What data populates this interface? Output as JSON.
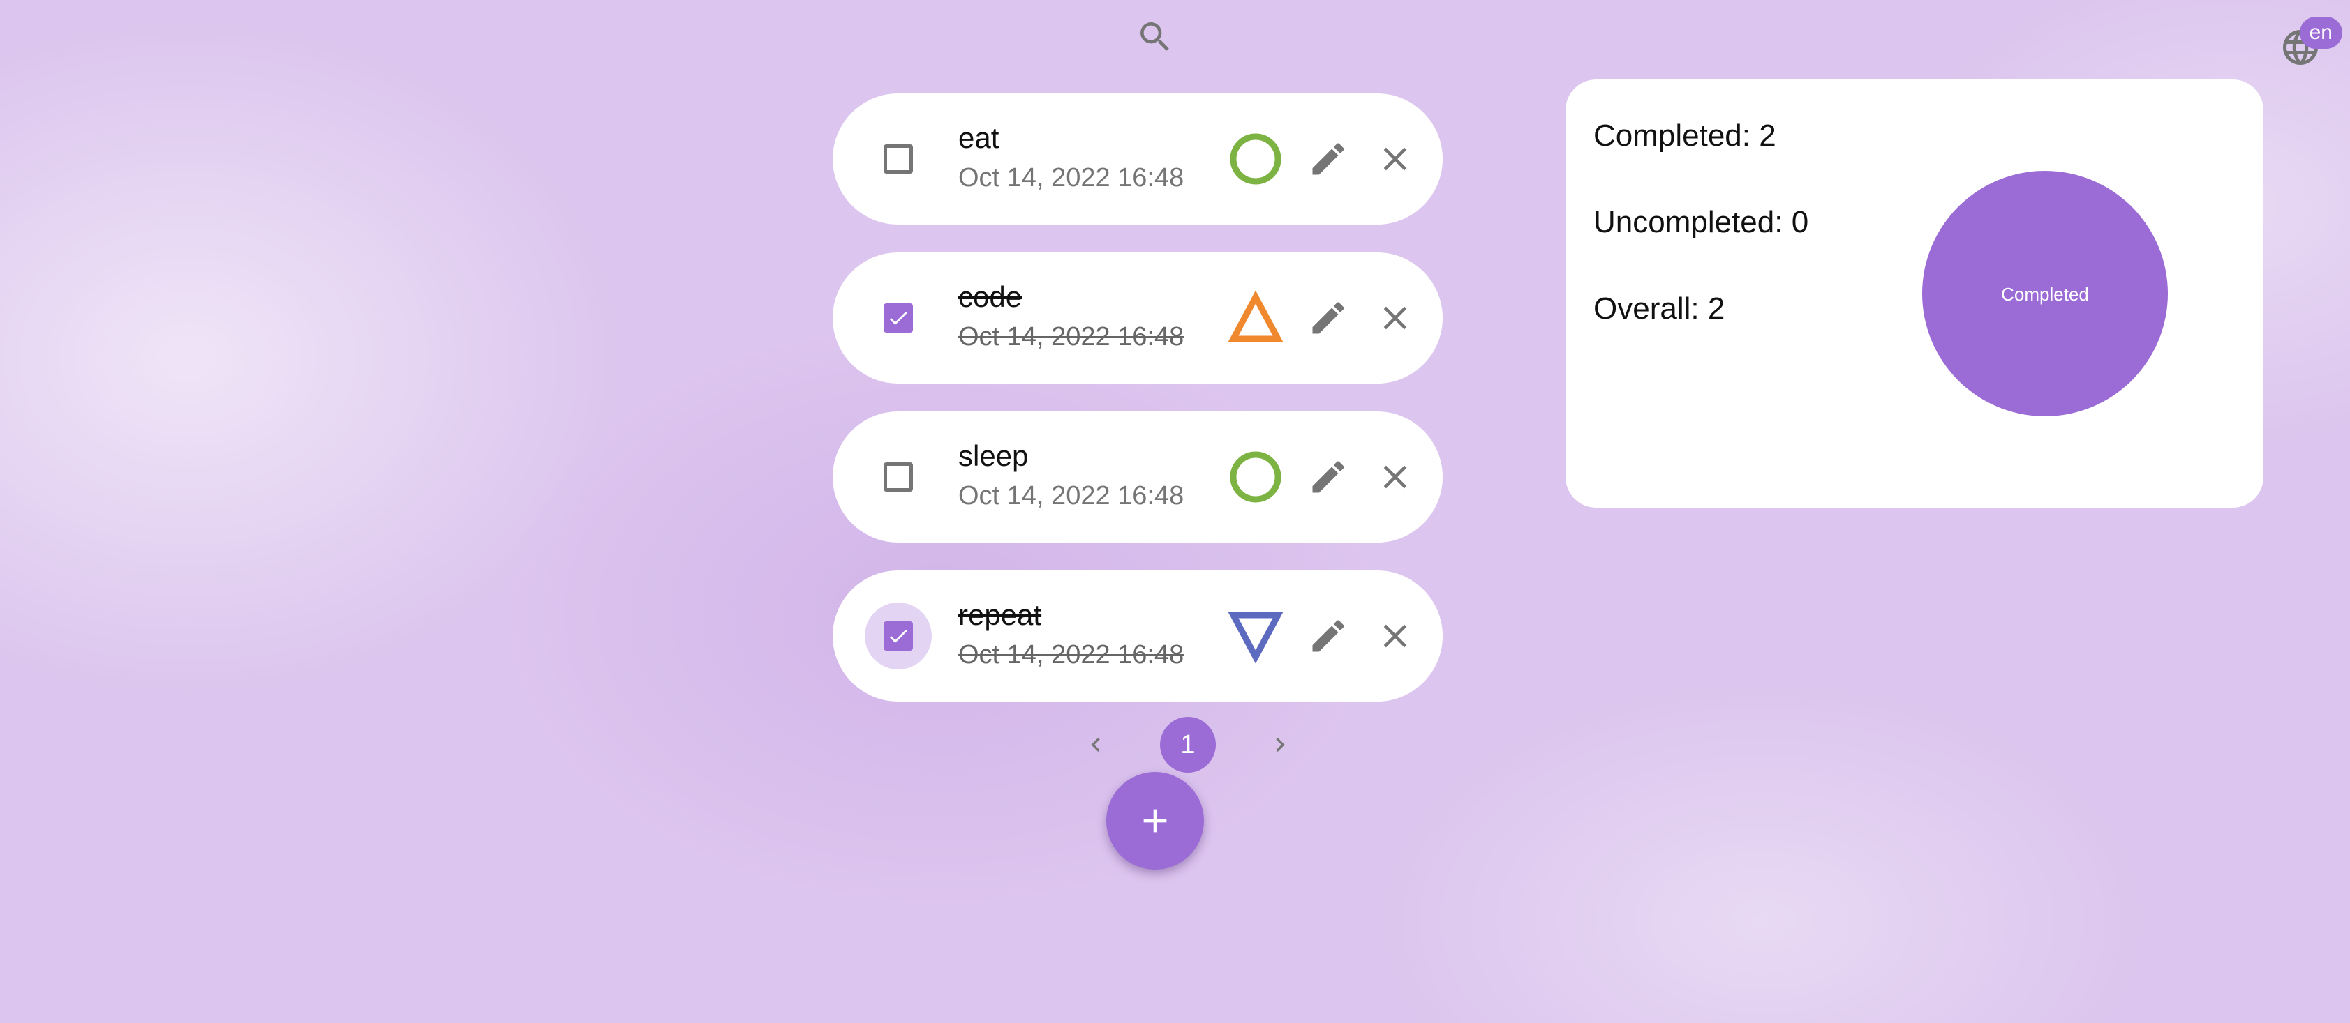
{
  "header": {
    "search_icon": "search-icon",
    "language_icon": "globe-icon",
    "language": "en"
  },
  "tasks": [
    {
      "title": "eat",
      "date": "Oct 14, 2022 16:48",
      "completed": false,
      "priority_icon": "circle-icon",
      "priority_color": "#7cb342"
    },
    {
      "title": "code",
      "date": "Oct 14, 2022 16:48",
      "completed": true,
      "priority_icon": "triangle-up-icon",
      "priority_color": "#f0882e"
    },
    {
      "title": "sleep",
      "date": "Oct 14, 2022 16:48",
      "completed": false,
      "priority_icon": "circle-icon",
      "priority_color": "#7cb342"
    },
    {
      "title": "repeat",
      "date": "Oct 14, 2022 16:48",
      "completed": true,
      "priority_icon": "triangle-down-icon",
      "priority_color": "#5c6bc0"
    }
  ],
  "pagination": {
    "current_page": "1"
  },
  "stats": {
    "completed": "Completed: 2",
    "uncompleted": "Uncompleted: 0",
    "overall": "Overall: 2",
    "pie_label": "Completed"
  },
  "colors": {
    "accent": "#9b6bd6",
    "icon_gray": "#757575"
  }
}
